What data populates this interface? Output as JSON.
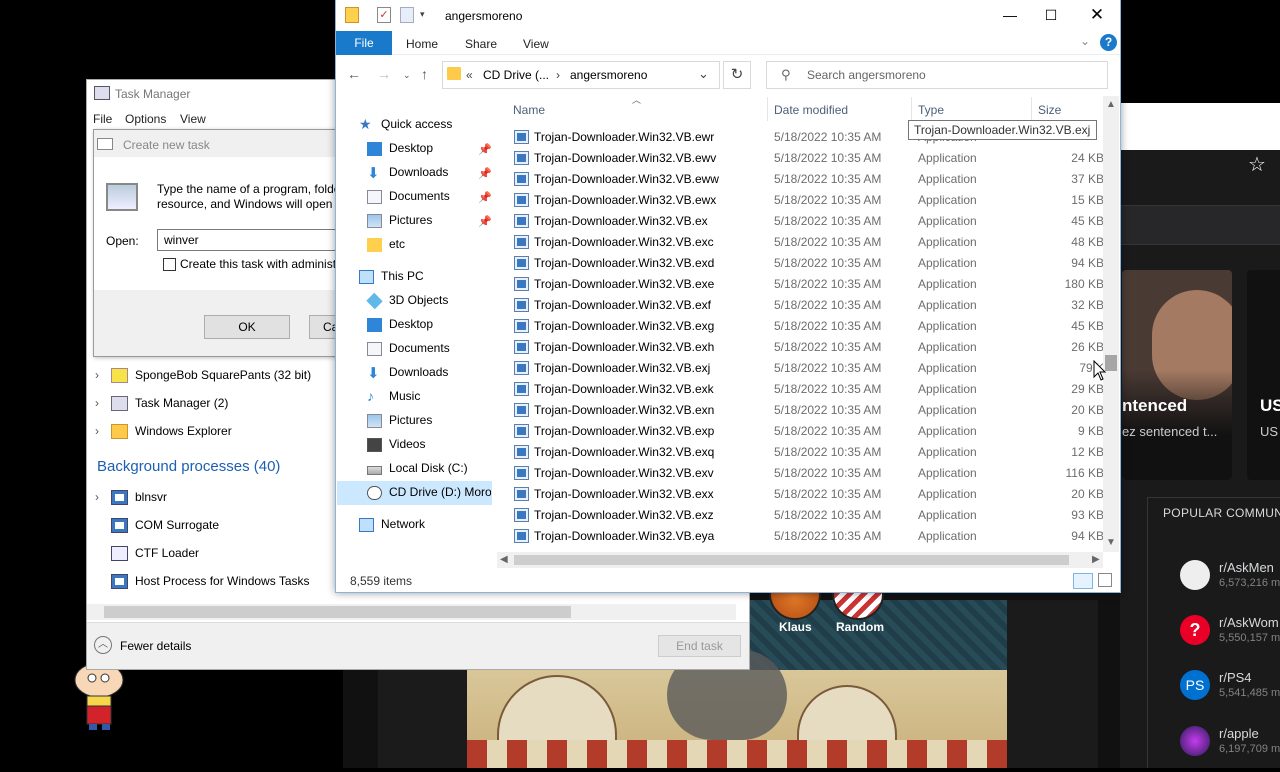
{
  "explorer": {
    "title": "angersmoreno",
    "window_controls": {
      "minimize": "—",
      "maximize": "☐",
      "close": "✕"
    },
    "ribbon_tabs": [
      "File",
      "Home",
      "Share",
      "View"
    ],
    "address": {
      "more": "«",
      "segment1": "CD Drive (...",
      "separator": "›",
      "segment2": "angersmoreno"
    },
    "search_placeholder": "Search angersmoreno",
    "nav_pane": {
      "quick_access": "Quick access",
      "quick_items": [
        "Desktop",
        "Downloads",
        "Documents",
        "Pictures",
        "etc"
      ],
      "this_pc": "This PC",
      "pc_items": [
        "3D Objects",
        "Desktop",
        "Documents",
        "Downloads",
        "Music",
        "Pictures",
        "Videos",
        "Local Disk (C:)",
        "CD Drive (D:) Moron"
      ],
      "network": "Network"
    },
    "columns": {
      "name": "Name",
      "date": "Date modified",
      "type": "Type",
      "size": "Size"
    },
    "files": [
      {
        "name": "Trojan-Downloader.Win32.VB.ewr",
        "date": "5/18/2022 10:35 AM",
        "type": "Application",
        "size": ""
      },
      {
        "name": "Trojan-Downloader.Win32.VB.ewv",
        "date": "5/18/2022 10:35 AM",
        "type": "Application",
        "size": "24 KB"
      },
      {
        "name": "Trojan-Downloader.Win32.VB.eww",
        "date": "5/18/2022 10:35 AM",
        "type": "Application",
        "size": "37 KB"
      },
      {
        "name": "Trojan-Downloader.Win32.VB.ewx",
        "date": "5/18/2022 10:35 AM",
        "type": "Application",
        "size": "15 KB"
      },
      {
        "name": "Trojan-Downloader.Win32.VB.ex",
        "date": "5/18/2022 10:35 AM",
        "type": "Application",
        "size": "45 KB"
      },
      {
        "name": "Trojan-Downloader.Win32.VB.exc",
        "date": "5/18/2022 10:35 AM",
        "type": "Application",
        "size": "48 KB"
      },
      {
        "name": "Trojan-Downloader.Win32.VB.exd",
        "date": "5/18/2022 10:35 AM",
        "type": "Application",
        "size": "94 KB"
      },
      {
        "name": "Trojan-Downloader.Win32.VB.exe",
        "date": "5/18/2022 10:35 AM",
        "type": "Application",
        "size": "180 KB"
      },
      {
        "name": "Trojan-Downloader.Win32.VB.exf",
        "date": "5/18/2022 10:35 AM",
        "type": "Application",
        "size": "32 KB"
      },
      {
        "name": "Trojan-Downloader.Win32.VB.exg",
        "date": "5/18/2022 10:35 AM",
        "type": "Application",
        "size": "45 KB"
      },
      {
        "name": "Trojan-Downloader.Win32.VB.exh",
        "date": "5/18/2022 10:35 AM",
        "type": "Application",
        "size": "26 KB"
      },
      {
        "name": "Trojan-Downloader.Win32.VB.exj",
        "date": "5/18/2022 10:35 AM",
        "type": "Application",
        "size": "79 K"
      },
      {
        "name": "Trojan-Downloader.Win32.VB.exk",
        "date": "5/18/2022 10:35 AM",
        "type": "Application",
        "size": "29 KB"
      },
      {
        "name": "Trojan-Downloader.Win32.VB.exn",
        "date": "5/18/2022 10:35 AM",
        "type": "Application",
        "size": "20 KB"
      },
      {
        "name": "Trojan-Downloader.Win32.VB.exp",
        "date": "5/18/2022 10:35 AM",
        "type": "Application",
        "size": "9 KB"
      },
      {
        "name": "Trojan-Downloader.Win32.VB.exq",
        "date": "5/18/2022 10:35 AM",
        "type": "Application",
        "size": "12 KB"
      },
      {
        "name": "Trojan-Downloader.Win32.VB.exv",
        "date": "5/18/2022 10:35 AM",
        "type": "Application",
        "size": "116 KB"
      },
      {
        "name": "Trojan-Downloader.Win32.VB.exx",
        "date": "5/18/2022 10:35 AM",
        "type": "Application",
        "size": "20 KB"
      },
      {
        "name": "Trojan-Downloader.Win32.VB.exz",
        "date": "5/18/2022 10:35 AM",
        "type": "Application",
        "size": "93 KB"
      },
      {
        "name": "Trojan-Downloader.Win32.VB.eya",
        "date": "5/18/2022 10:35 AM",
        "type": "Application",
        "size": "94 KB"
      }
    ],
    "tooltip": "Trojan-Downloader.Win32.VB.exj",
    "status": "8,559 items"
  },
  "task_manager": {
    "title": "Task Manager",
    "menu": [
      "File",
      "Options",
      "View"
    ],
    "apps": [
      "SpongeBob SquarePants (32 bit)",
      "Task Manager (2)",
      "Windows Explorer"
    ],
    "background_header": "Background processes (40)",
    "background": [
      "blnsvr",
      "COM Surrogate",
      "CTF Loader",
      "Host Process for Windows Tasks"
    ],
    "fewer_details": "Fewer details",
    "end_task": "End task"
  },
  "run_dialog": {
    "title": "Create new task",
    "text_line1": "Type the name of a program, folde",
    "text_line2": "resource, and Windows will open",
    "open_label": "Open:",
    "open_value": "winver",
    "admin_label": "Create this task with administ",
    "ok": "OK",
    "cancel": "Ca"
  },
  "browser": {
    "news": [
      {
        "title": "ntenced",
        "subtitle": "ez sentenced t..."
      },
      {
        "title": "US",
        "subtitle": "US"
      }
    ],
    "popular_title": "POPULAR COMMUNIT",
    "communities": [
      {
        "name": "r/AskMen",
        "members": "6,573,216 m"
      },
      {
        "name": "r/AskWom",
        "members": "5,550,157 m"
      },
      {
        "name": "r/PS4",
        "members": "5,541,485 m"
      },
      {
        "name": "r/apple",
        "members": "6,197,709 m"
      }
    ]
  },
  "game": {
    "characters": [
      "Klaus",
      "Random"
    ]
  },
  "colors": {
    "accent": "#1979ca",
    "selected": "#cce8ff",
    "header_blue": "#1c5fb3"
  }
}
